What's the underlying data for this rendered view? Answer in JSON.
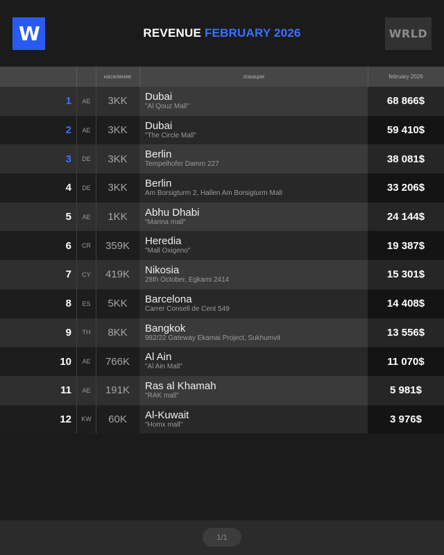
{
  "header": {
    "logo_letter": "W",
    "title_main": "REVENUE",
    "title_accent": "FEBRUARY 2026",
    "wrld_label": "WRLD",
    "accent_color": "#3a72ff"
  },
  "table": {
    "columns": {
      "population": "население",
      "locations": "локации",
      "revenue": "february 2026"
    },
    "rows": [
      {
        "rank": "1",
        "cc": "AE",
        "pop": "3KK",
        "city": "Dubai",
        "addr": "\"Al Qouz Mall\"",
        "revenue": "68 866$"
      },
      {
        "rank": "2",
        "cc": "AE",
        "pop": "3KK",
        "city": "Dubai",
        "addr": "\"The Circle Mall\"",
        "revenue": "59 410$"
      },
      {
        "rank": "3",
        "cc": "DE",
        "pop": "3KK",
        "city": "Berlin",
        "addr": "Tempelhofer Damm 227",
        "revenue": "38 081$"
      },
      {
        "rank": "4",
        "cc": "DE",
        "pop": "3KK",
        "city": "Berlin",
        "addr": "Am Borsigturm 2, Hallen Am Borsigturm Mall",
        "revenue": "33 206$"
      },
      {
        "rank": "5",
        "cc": "AE",
        "pop": "1KK",
        "city": "Abhu Dhabi",
        "addr": "\"Marina mall\"",
        "revenue": "24 144$"
      },
      {
        "rank": "6",
        "cc": "CR",
        "pop": "359K",
        "city": "Heredia",
        "addr": "\"Mall Oxigeno\"",
        "revenue": "19 387$"
      },
      {
        "rank": "7",
        "cc": "CY",
        "pop": "419K",
        "city": "Nikosia",
        "addr": "28th October, Egkami 2414",
        "revenue": "15 301$"
      },
      {
        "rank": "8",
        "cc": "ES",
        "pop": "5KK",
        "city": "Barcelona",
        "addr": "Carrer Consell de Cent 549",
        "revenue": "14 408$"
      },
      {
        "rank": "9",
        "cc": "TH",
        "pop": "8KK",
        "city": "Bangkok",
        "addr": "982/22 Gateway Ekamai Project, Sukhumvit",
        "revenue": "13 556$"
      },
      {
        "rank": "10",
        "cc": "AE",
        "pop": "766K",
        "city": "Al Ain",
        "addr": "\"Al Ain Mall\"",
        "revenue": "11 070$"
      },
      {
        "rank": "11",
        "cc": "AE",
        "pop": "191K",
        "city": "Ras al Khamah",
        "addr": "\"RAK mall\"",
        "revenue": "5 981$"
      },
      {
        "rank": "12",
        "cc": "KW",
        "pop": "60K",
        "city": "Al-Kuwait",
        "addr": "\"Homx mall\"",
        "revenue": "3 976$"
      }
    ]
  },
  "footer": {
    "page_indicator": "1/1"
  }
}
